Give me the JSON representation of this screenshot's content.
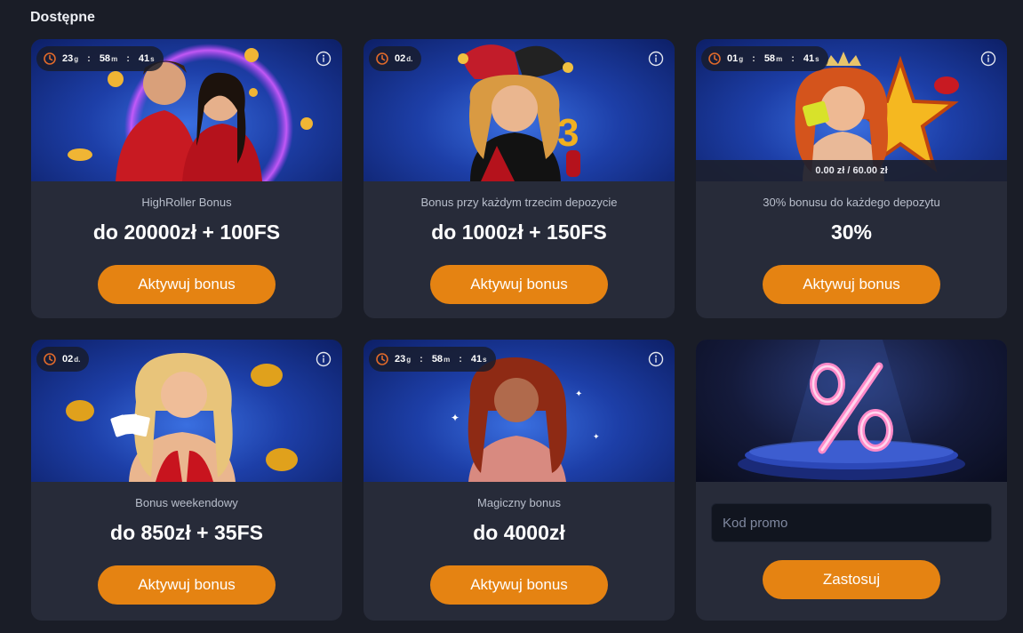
{
  "section_title": "Dostępne",
  "cards": [
    {
      "timer": [
        {
          "value": "23",
          "unit": "g"
        },
        {
          "value": "58",
          "unit": "m"
        },
        {
          "value": "41",
          "unit": "s"
        }
      ],
      "subtitle": "HighRoller Bonus",
      "amount": "do 20000zł + 100FS",
      "button": "Aktywuj bonus"
    },
    {
      "timer": [
        {
          "value": "02",
          "unit": "d."
        }
      ],
      "subtitle": "Bonus przy każdym trzecim depozycie",
      "amount": "do 1000zł + 150FS",
      "button": "Aktywuj bonus"
    },
    {
      "timer": [
        {
          "value": "01",
          "unit": "g"
        },
        {
          "value": "58",
          "unit": "m"
        },
        {
          "value": "41",
          "unit": "s"
        }
      ],
      "progress": "0.00 zł / 60.00 zł",
      "subtitle": "30% bonusu do każdego depozytu",
      "amount": "30%",
      "button": "Aktywuj bonus"
    },
    {
      "timer": [
        {
          "value": "02",
          "unit": "d."
        }
      ],
      "subtitle": "Bonus weekendowy",
      "amount": "do 850zł + 35FS",
      "button": "Aktywuj bonus"
    },
    {
      "timer": [
        {
          "value": "23",
          "unit": "g"
        },
        {
          "value": "58",
          "unit": "m"
        },
        {
          "value": "41",
          "unit": "s"
        }
      ],
      "subtitle": "Magiczny bonus",
      "amount": "do 4000zł",
      "button": "Aktywuj bonus"
    }
  ],
  "promo": {
    "placeholder": "Kod promo",
    "button": "Zastosuj"
  },
  "colors": {
    "background": "#1a1d27",
    "card": "#272b39",
    "accent": "#e58312",
    "input": "#11151f"
  },
  "icons": [
    "clock-icon",
    "info-icon",
    "percent-icon"
  ]
}
